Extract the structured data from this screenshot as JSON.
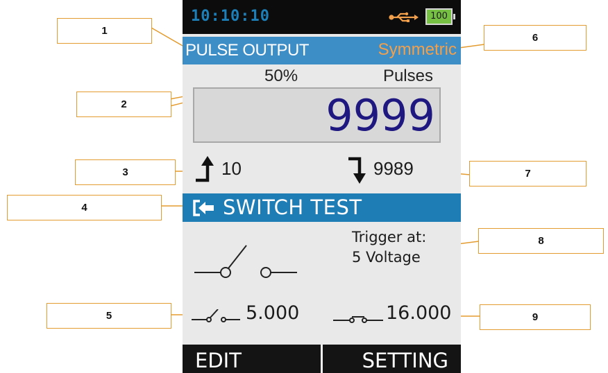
{
  "status_bar": {
    "time": "10:10:10",
    "battery_level": "100",
    "usb_icon": "usb-icon"
  },
  "header": {
    "title": "PULSE OUTPUT",
    "mode": "Symmetric"
  },
  "readout": {
    "duty_cycle": "50%",
    "label": "Pulses",
    "count": "9999"
  },
  "edges": {
    "rising": "10",
    "falling": "9989",
    "rising_icon": "rising-edge-arrow-icon",
    "falling_icon": "falling-edge-arrow-icon"
  },
  "switch_test": {
    "label": "SWITCH TEST",
    "icon": "enter-arrow-icon"
  },
  "trigger": {
    "label": "Trigger at:",
    "value": "5 Voltage"
  },
  "switch_values": {
    "open": "5.000",
    "closed": "16.000"
  },
  "softkeys": {
    "left": "EDIT",
    "right": "SETTING"
  },
  "callouts": [
    "1",
    "2",
    "3",
    "4",
    "5",
    "6",
    "7",
    "8",
    "9"
  ],
  "colors": {
    "screen_bg": "#e9e9e9",
    "status_bar_bg": "#0c0c0c",
    "clock": "#1d7fb8",
    "title_bar_bg": "#3d8dc7",
    "mode_text": "#f3a04b",
    "count_text": "#1f1880",
    "switch_bar_bg": "#1f7db6",
    "battery_fill": "#76c043",
    "callout_border": "#e39b2f"
  }
}
